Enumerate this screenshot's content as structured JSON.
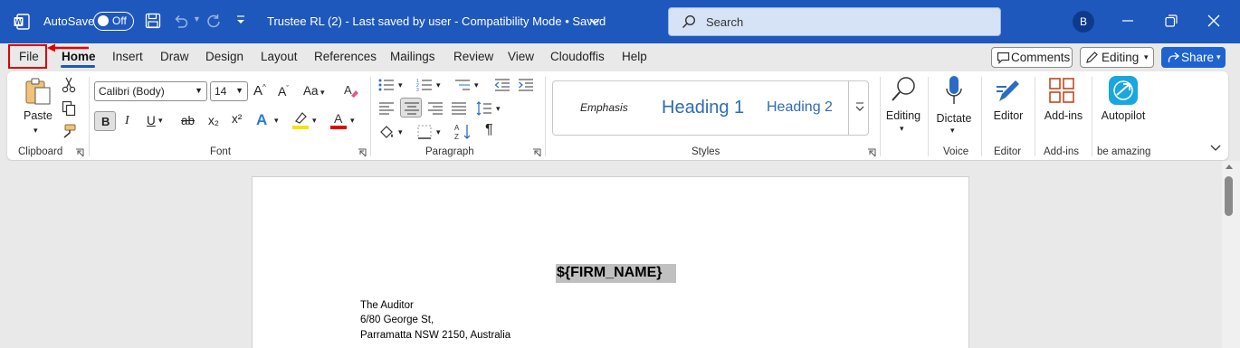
{
  "titlebar": {
    "autosave_label": "AutoSave",
    "autosave_state": "Off",
    "document_title": "Trustee RL (2)  -  Last saved by user  -  Compatibility Mode • Saved",
    "search_placeholder": "Search",
    "user_initial": "B"
  },
  "menu": {
    "tabs": [
      "File",
      "Home",
      "Insert",
      "Draw",
      "Design",
      "Layout",
      "References",
      "Mailings",
      "Review",
      "View",
      "Cloudoffis",
      "Help"
    ],
    "active_tab": "Home",
    "comments_label": "Comments",
    "editing_label": "Editing",
    "share_label": "Share"
  },
  "ribbon": {
    "clipboard": {
      "paste_label": "Paste",
      "group_label": "Clipboard"
    },
    "font": {
      "font_name": "Calibri (Body)",
      "font_size": "14",
      "group_label": "Font",
      "bold": "B",
      "italic": "I",
      "underline": "U",
      "strike": "ab",
      "subscript": "x₂",
      "superscript": "x²",
      "case": "Aa"
    },
    "paragraph": {
      "group_label": "Paragraph"
    },
    "styles": {
      "items": [
        "Emphasis",
        "Heading 1",
        "Heading 2"
      ],
      "group_label": "Styles"
    },
    "editing": {
      "label": "Editing"
    },
    "voice": {
      "dictate_label": "Dictate",
      "group_label": "Voice"
    },
    "editor": {
      "label": "Editor",
      "group_label": "Editor"
    },
    "addins": {
      "label": "Add-ins",
      "group_label": "Add-ins"
    },
    "autopilot": {
      "label": "Autopilot",
      "group_label": "be amazing"
    }
  },
  "document": {
    "firm_placeholder": "${FIRM_NAME}",
    "address_lines": [
      "The Auditor",
      "6/80 George St,",
      "Parramatta NSW 2150, Australia"
    ]
  },
  "colors": {
    "titlebar": "#1e58bd",
    "share_button": "#1e63d0",
    "highlight_marker": "#e10000"
  }
}
